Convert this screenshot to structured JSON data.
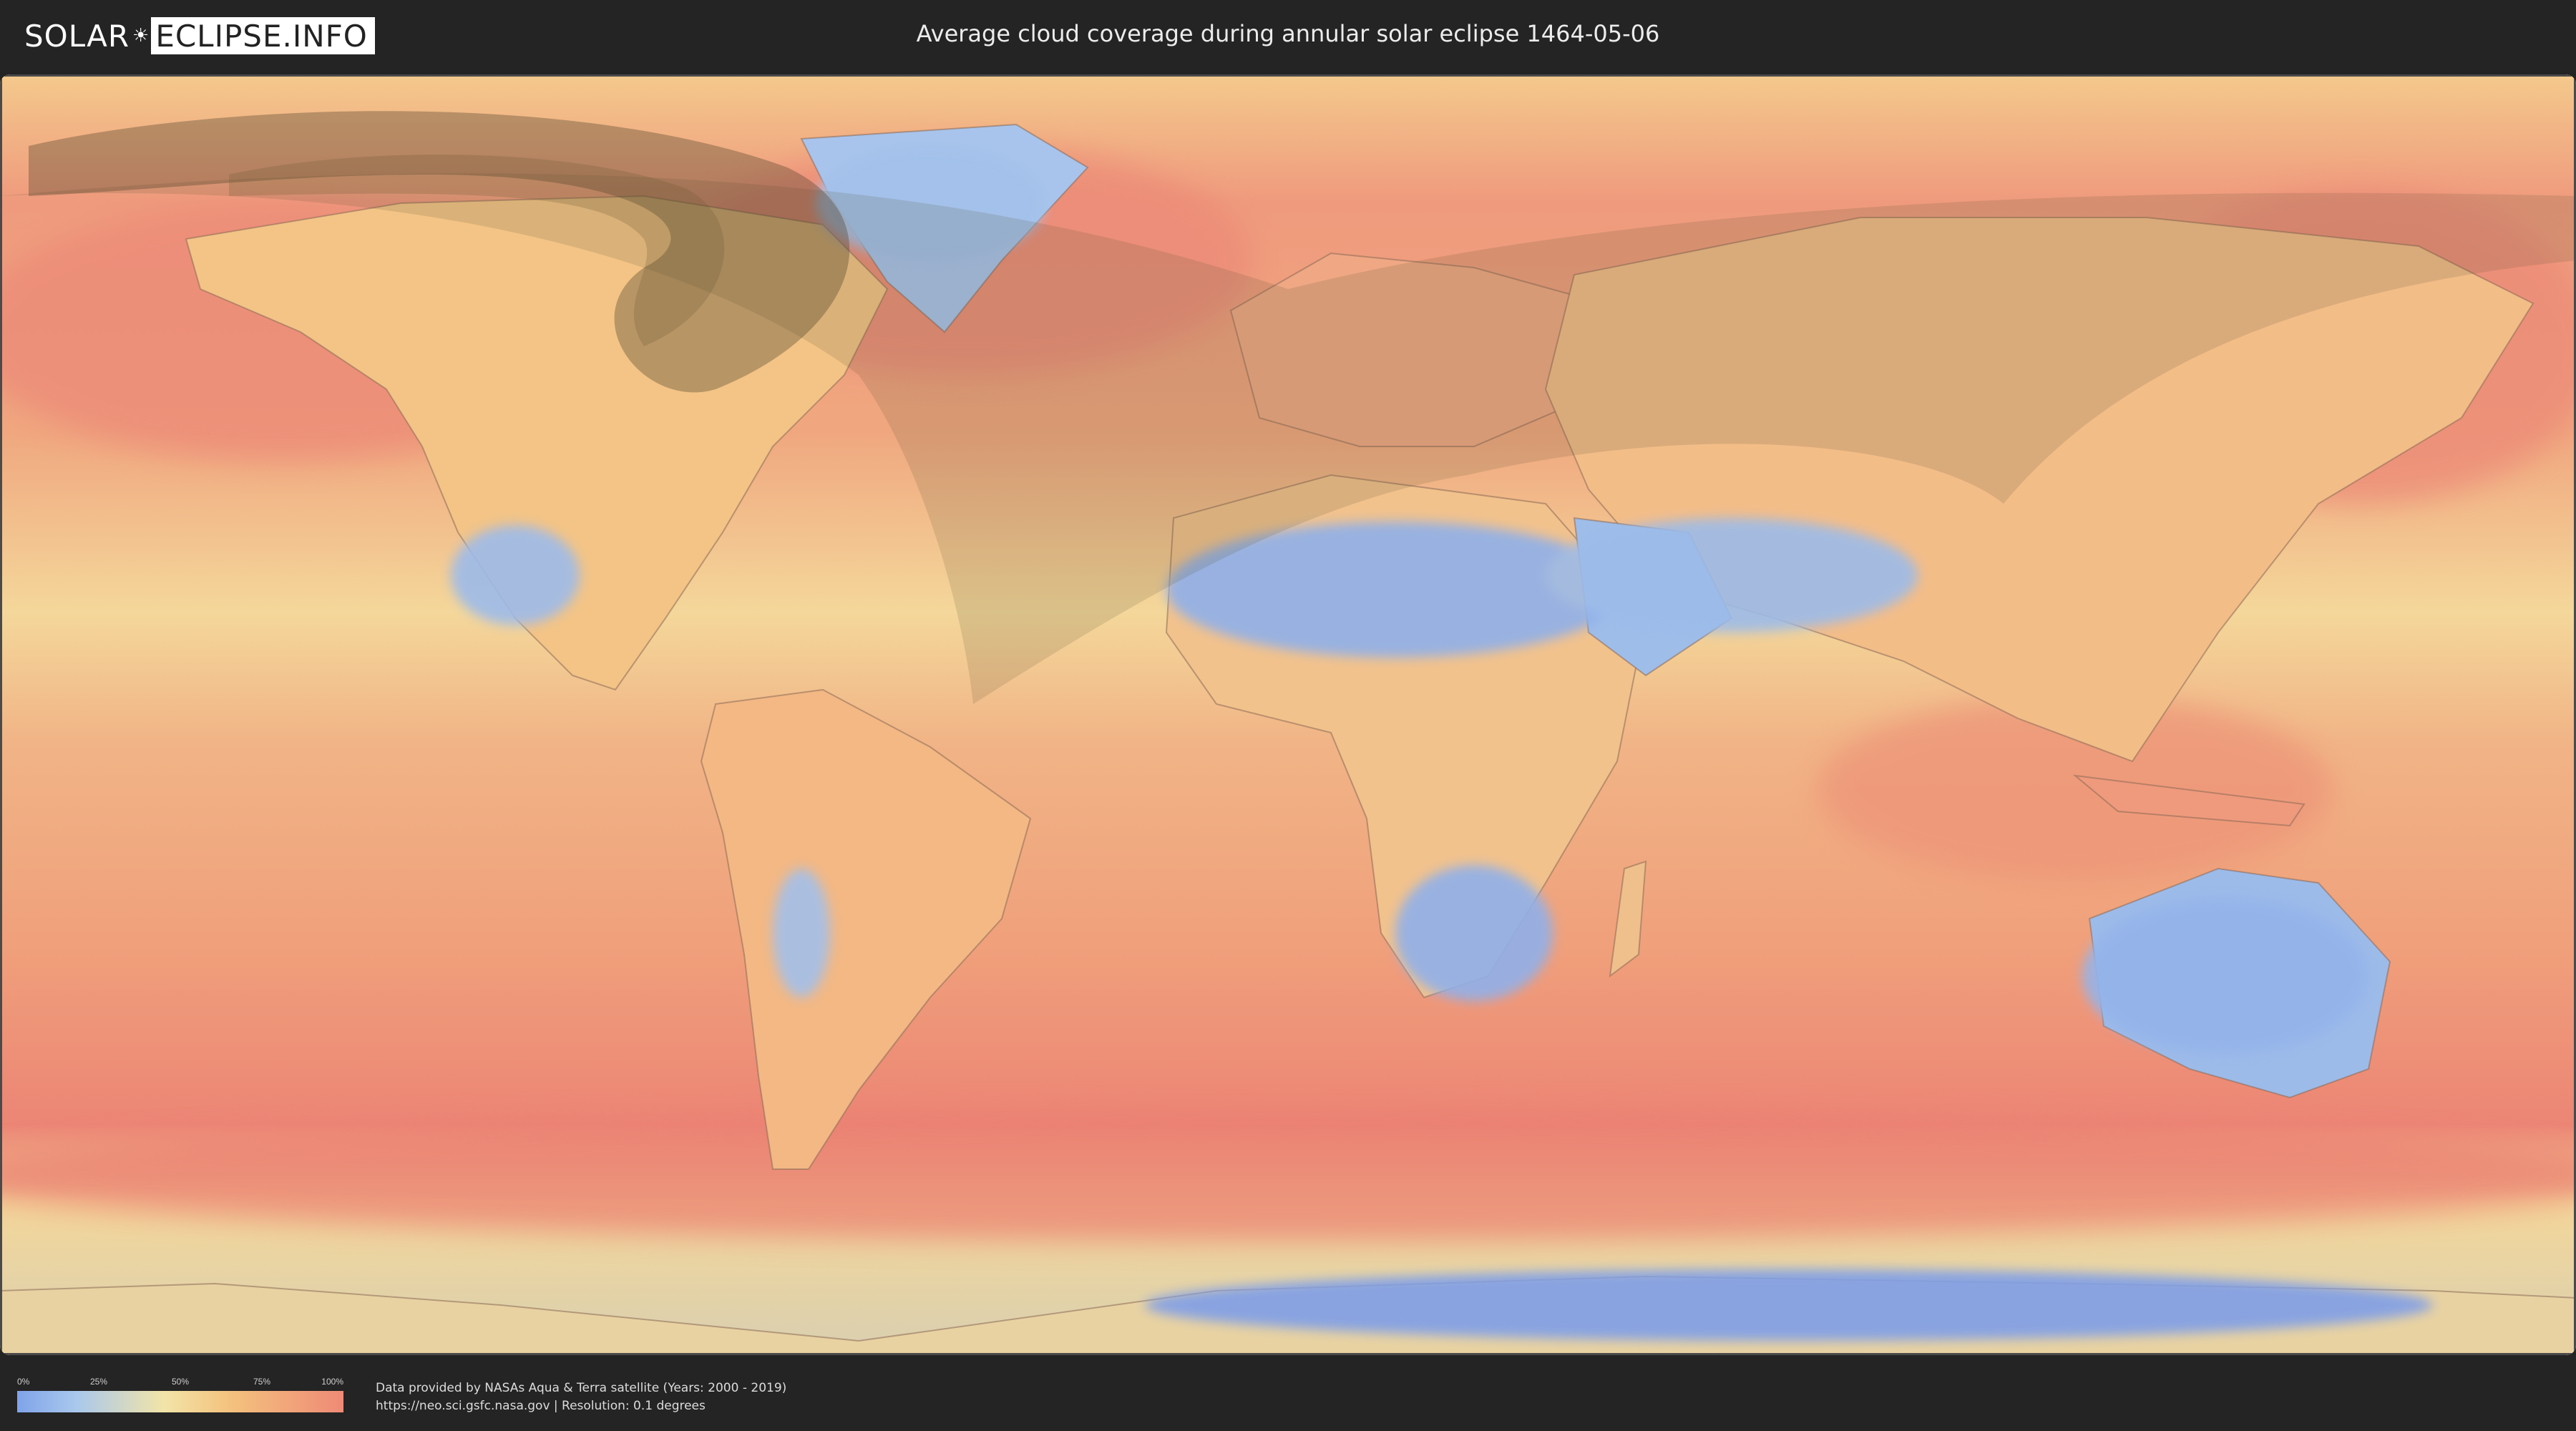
{
  "header": {
    "logo_left": "SOLAR",
    "logo_right": "ECLIPSE.INFO",
    "title": "Average cloud coverage during annular solar eclipse 1464-05-06"
  },
  "legend": {
    "ticks": [
      "0%",
      "25%",
      "50%",
      "75%",
      "100%"
    ],
    "colors": [
      "#7fa3ea",
      "#f2e4a8",
      "#ef8a76"
    ]
  },
  "footer": {
    "credit_line1": "Data provided by NASAs Aqua & Terra satellite (Years: 2000 - 2019)",
    "credit_line2": "https://neo.sci.gsfc.nasa.gov | Resolution: 0.1 degrees"
  },
  "map": {
    "projection": "equirectangular",
    "palette": {
      "clear": "#7fa3ea",
      "partly": "#f2e4a8",
      "cloudy": "#ef8a76",
      "eclipse_shadow": "#5a5030"
    }
  }
}
